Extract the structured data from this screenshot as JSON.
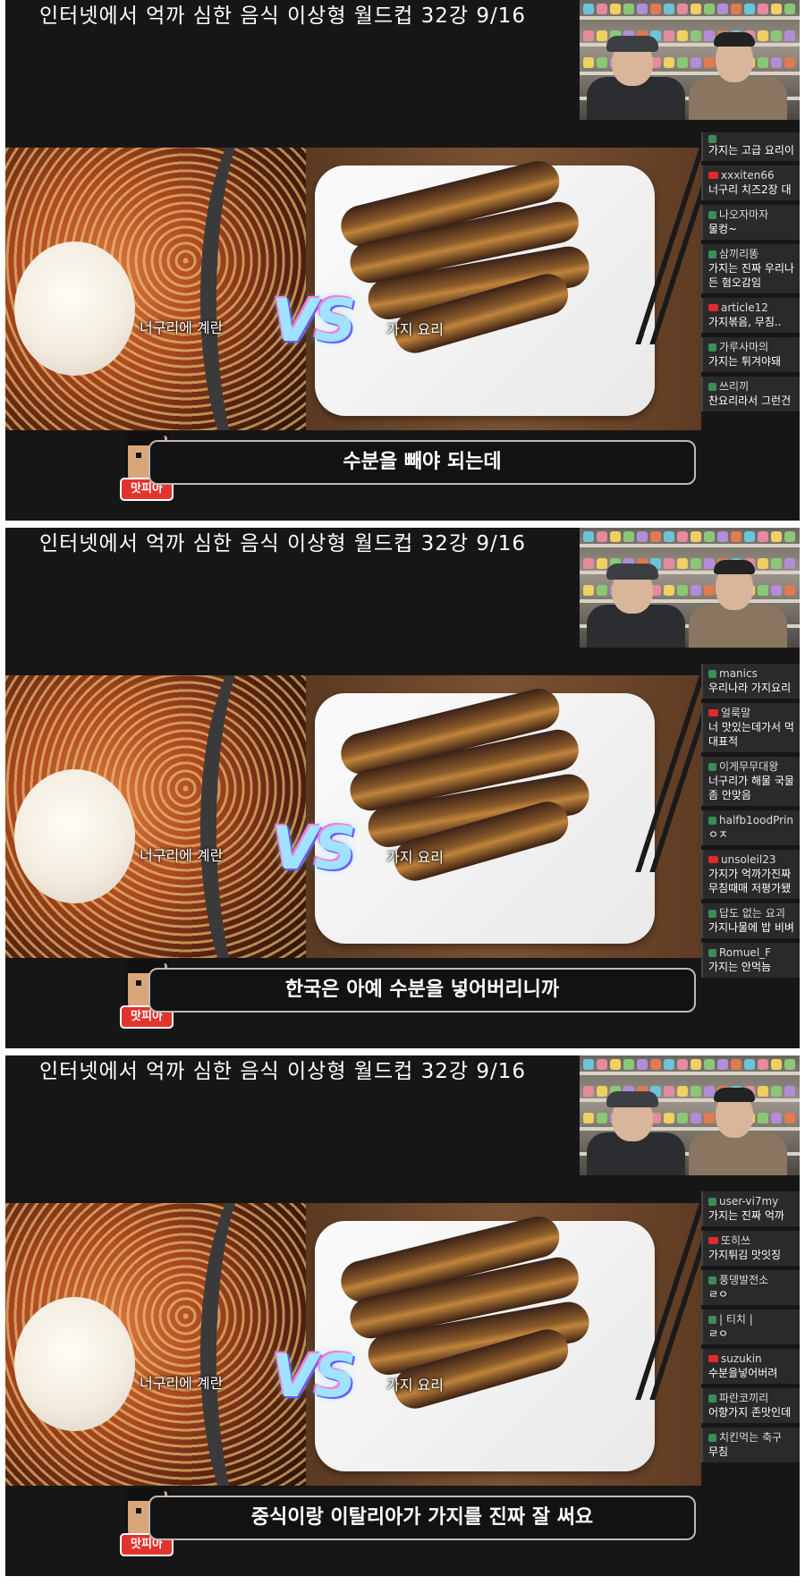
{
  "panels": [
    {
      "title": "인터넷에서 억까 심한 음식 이상형 월드컵   32강   9/16",
      "left_label": "너구리에 계란",
      "right_label": "가지 요리",
      "vs": "VS",
      "subtitle": "수분을 빼야 되는데",
      "avatar_tag": "맛피아",
      "chat": [
        {
          "user": "",
          "text": "가지는 고급 요리이"
        },
        {
          "user": "xxxiten66",
          "text": "너구리 치즈2장 대"
        },
        {
          "user": "나오자마자",
          "text": "물컹~"
        },
        {
          "user": "삼끼리똥",
          "text": "가지는 진짜 우리나",
          "text2": "든 혐오감임"
        },
        {
          "user": "article12",
          "text": "가지볶음, 무침.."
        },
        {
          "user": "가루사마의",
          "text": "가지는 튀겨야돼"
        },
        {
          "user": "쓰리끼",
          "text": "찬요리라서 그런건"
        }
      ]
    },
    {
      "title": "인터넷에서 억까 심한 음식 이상형 월드컵   32강   9/16",
      "left_label": "너구리에 계란",
      "right_label": "가지 요리",
      "vs": "VS",
      "subtitle": "한국은 아예 수분을 넣어버리니까",
      "avatar_tag": "맛피아",
      "chat": [
        {
          "user": "manics",
          "text": "우리나라 가지요리"
        },
        {
          "user": "얼룩말",
          "text": "너 맛있는데가서 먹",
          "text2": "대표적"
        },
        {
          "user": "이게무무대왕",
          "text": "너구리가 해물 국물",
          "text2": "좀 안맞음"
        },
        {
          "user": "halfb1oodPrin",
          "text": "ㅇㅈ"
        },
        {
          "user": "unsoleil23",
          "text": "가지가 억까가진짜",
          "text2": "무침때매 저평가됐"
        },
        {
          "user": "답도 없는 요괴",
          "text": "가지나물에 밥 비벼"
        },
        {
          "user": "Romuel_F",
          "text": "가지는 안먹늠"
        }
      ]
    },
    {
      "title": "인터넷에서 억까 심한 음식 이상형 월드컵   32강   9/16",
      "left_label": "너구리에 계란",
      "right_label": "가지 요리",
      "vs": "VS",
      "subtitle": "중식이랑 이탈리아가 가지를 진짜 잘 써요",
      "avatar_tag": "맛피아",
      "chat": [
        {
          "user": "user-vi7my",
          "text": "가지는 진짜 억까"
        },
        {
          "user": "또히쓰",
          "text": "가지튀김 맛잇징"
        },
        {
          "user": "풍뎅발전소",
          "text": "ㄹㅇ"
        },
        {
          "user": "| 티치 |",
          "text": "ㄹㅇ"
        },
        {
          "user": "suzukin",
          "text": "수분을넣어버려"
        },
        {
          "user": "파란코끼리",
          "text": "어향가지 존맛인데"
        },
        {
          "user": "치킨먹는 축구",
          "text": "무침"
        }
      ]
    }
  ]
}
